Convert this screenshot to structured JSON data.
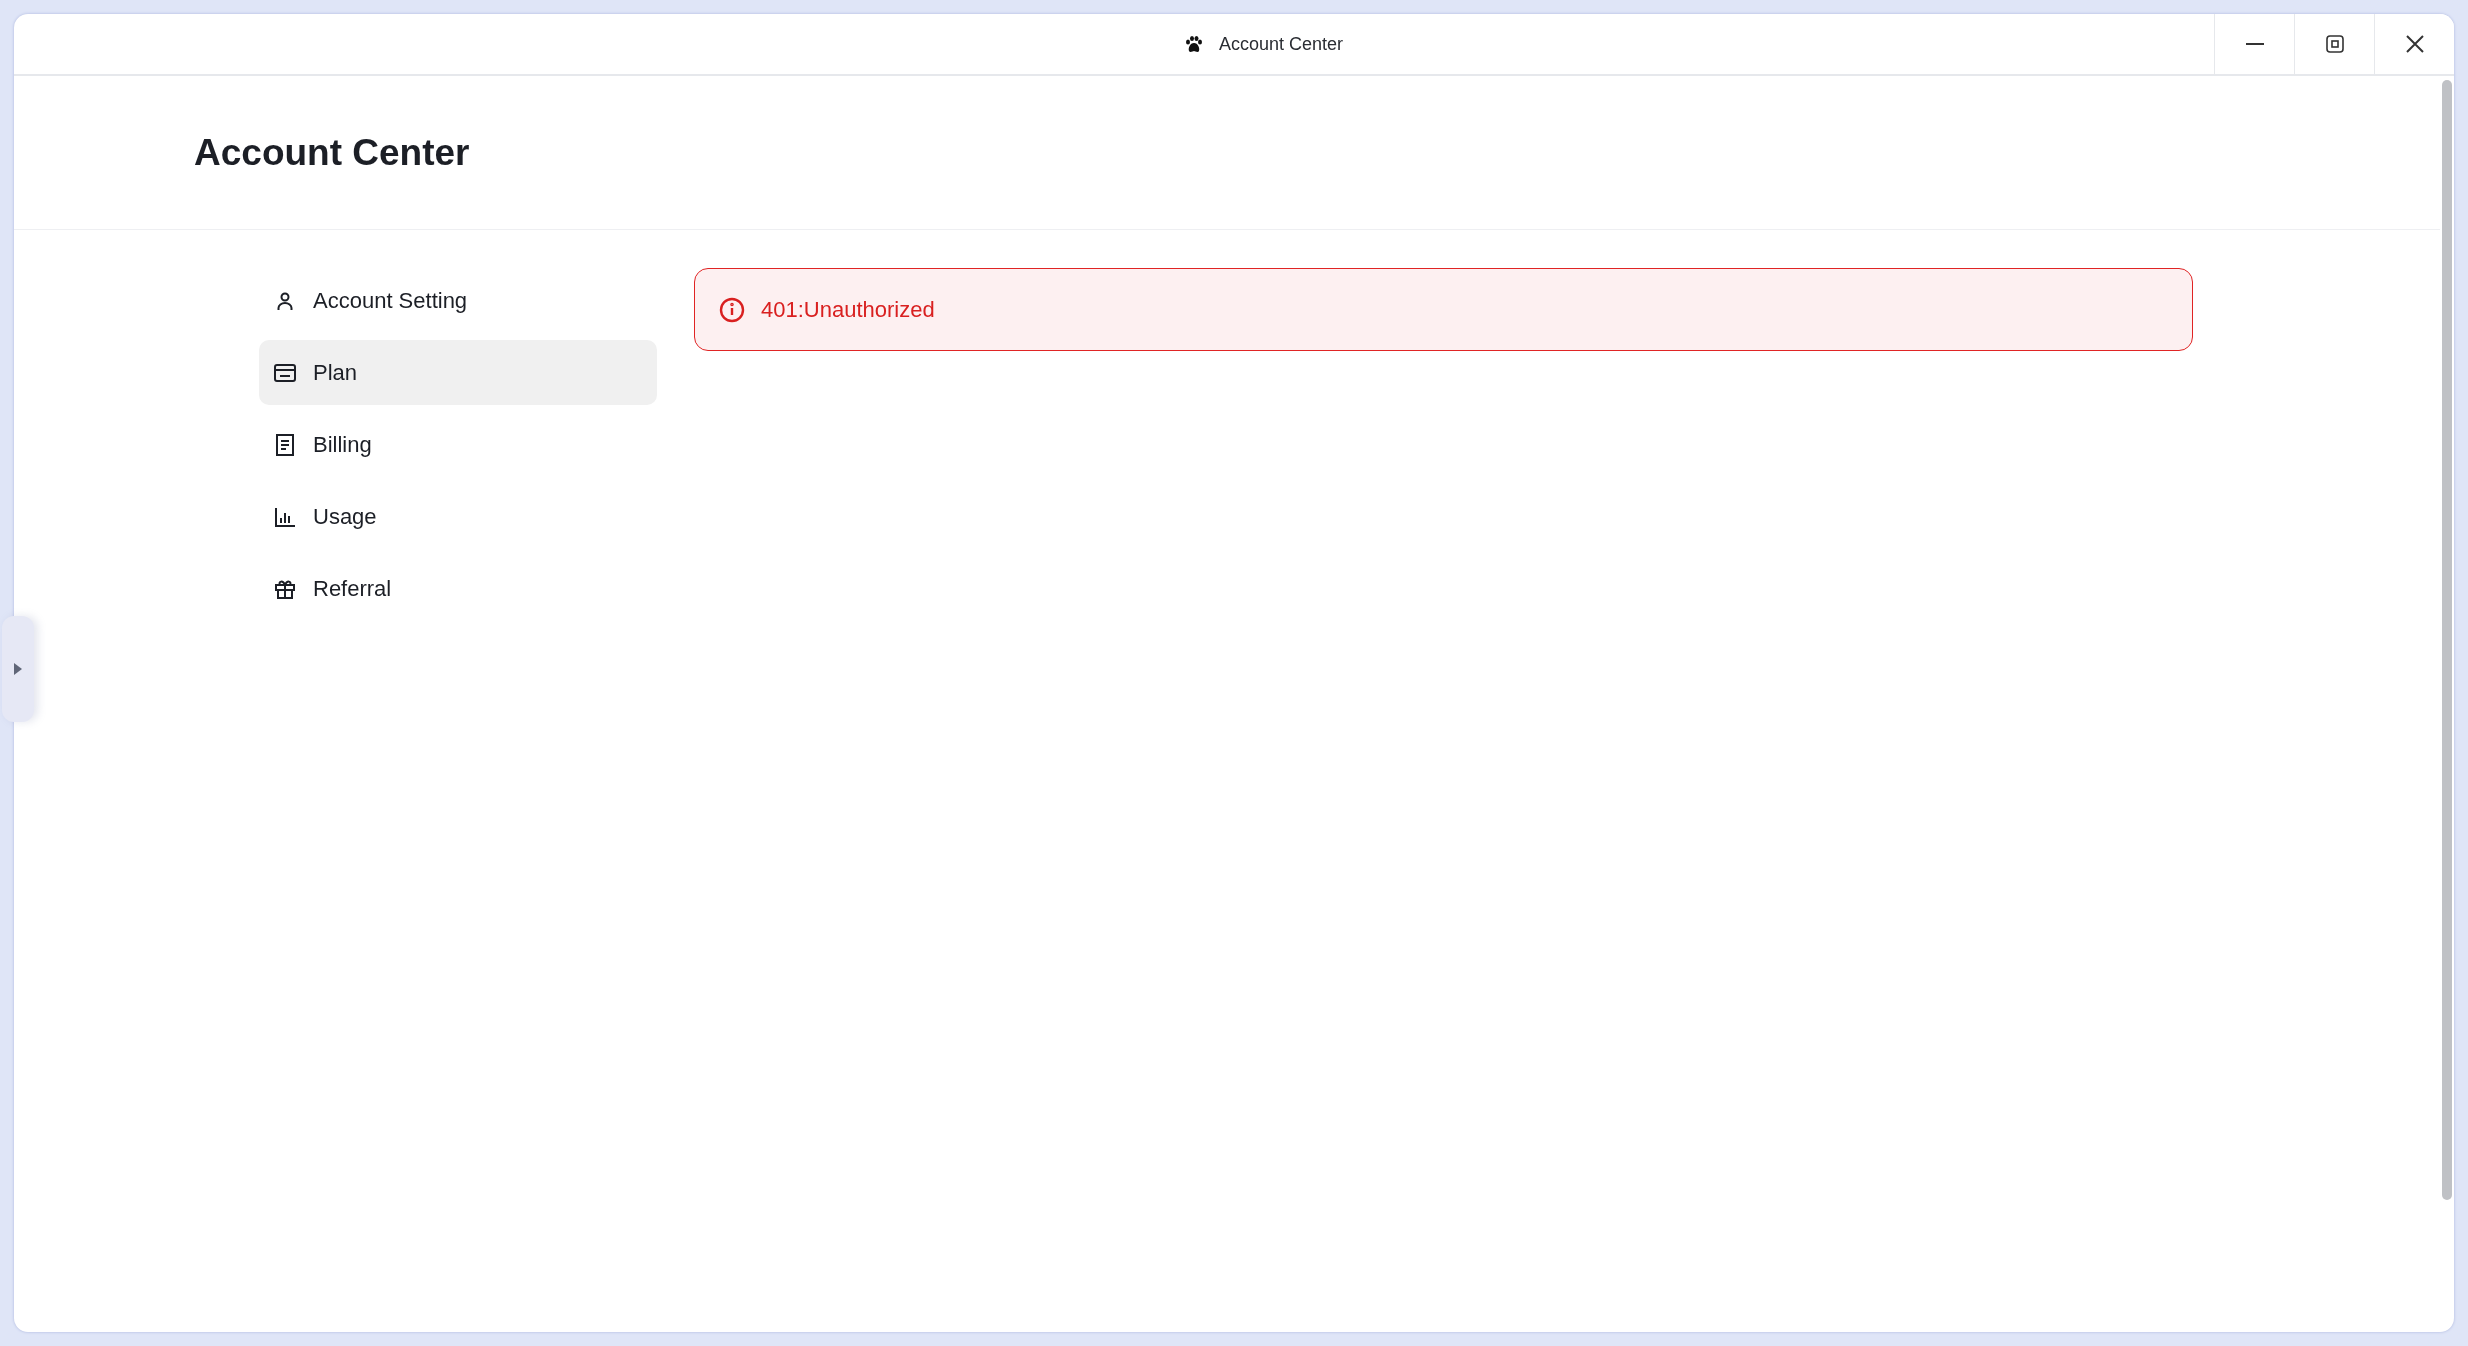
{
  "window": {
    "title": "Account Center"
  },
  "page": {
    "title": "Account Center"
  },
  "sidebar": {
    "items": [
      {
        "label": "Account Setting",
        "selected": false
      },
      {
        "label": "Plan",
        "selected": true
      },
      {
        "label": "Billing",
        "selected": false
      },
      {
        "label": "Usage",
        "selected": false
      },
      {
        "label": "Referral",
        "selected": false
      }
    ]
  },
  "alert": {
    "message": "401:Unauthorized"
  }
}
